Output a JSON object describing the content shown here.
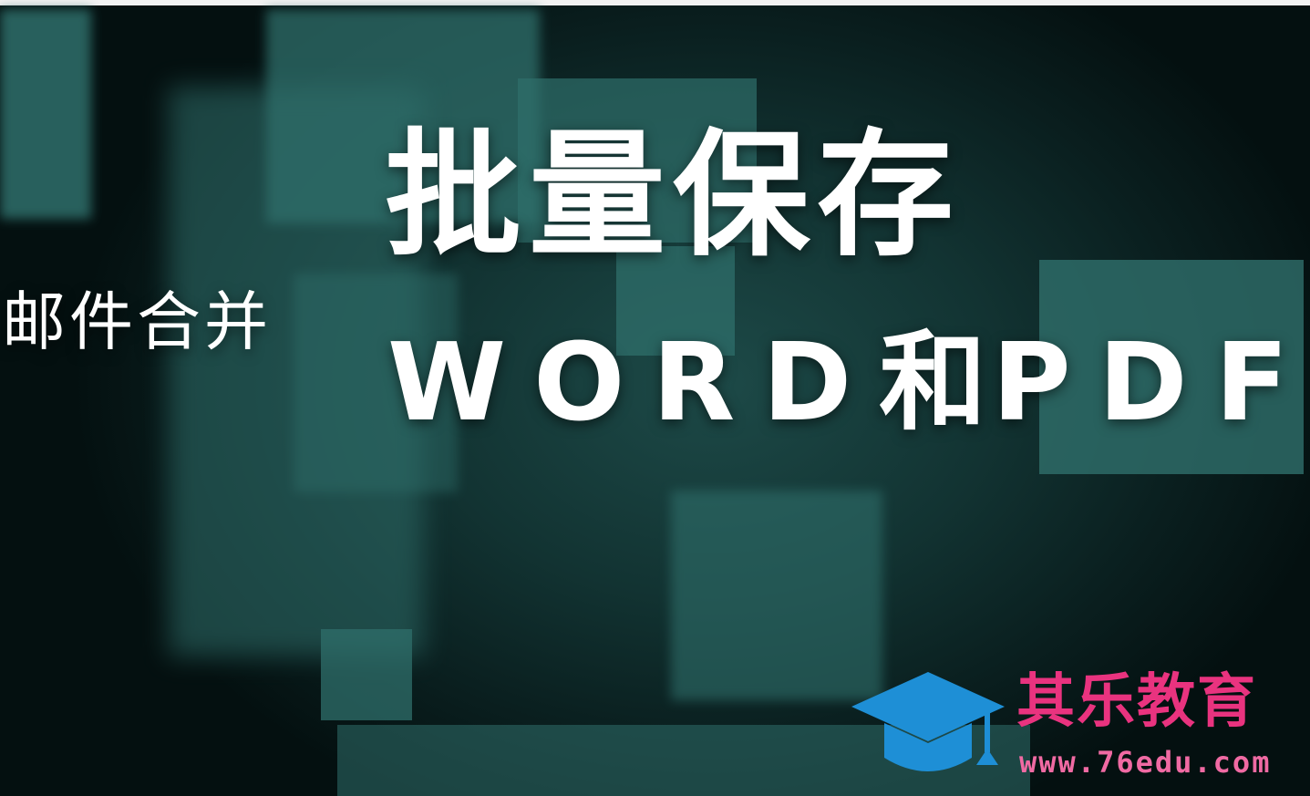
{
  "title_line1": "批量保存",
  "title_line2_word": "WORD",
  "title_line2_mid": "和",
  "title_line2_pdf": "PDF",
  "side_label": "邮件合并",
  "brand": {
    "name": "其乐教育",
    "url": "www.76edu.com",
    "icon": "graduation-cap-icon",
    "name_color": "#e9337f",
    "icon_color": "#1e8fd6"
  },
  "colors": {
    "background": "#0a1f1f",
    "squares": "#2f6f6b",
    "text": "#ffffff"
  }
}
